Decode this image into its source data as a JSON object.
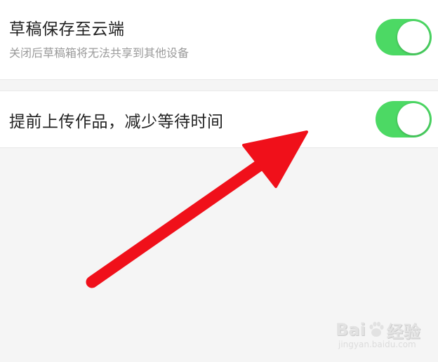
{
  "settings": {
    "draft": {
      "title": "草稿保存至云端",
      "description": "关闭后草稿箱将无法共享到其他设备",
      "enabled": true
    },
    "upload": {
      "title": "提前上传作品，减少等待时间",
      "enabled": true
    }
  },
  "watermark": {
    "brand_left": "Bai",
    "brand_right": "经验",
    "url": "jingyan.baidu.com"
  },
  "colors": {
    "toggle_on": "#4cd964",
    "arrow": "#f0101a"
  },
  "icons": {
    "annotation": "red-arrow-icon",
    "watermark": "baidu-paw-icon"
  }
}
